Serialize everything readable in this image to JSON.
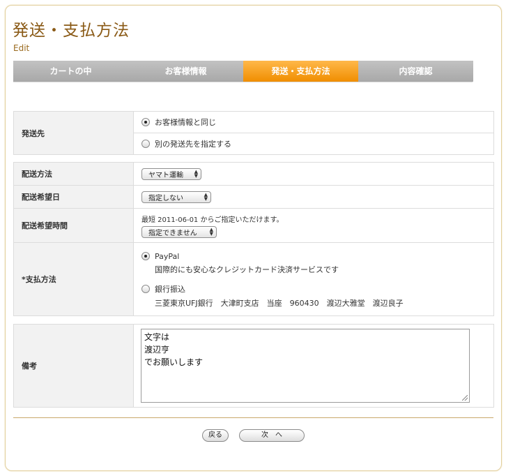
{
  "page": {
    "title": "発送・支払方法",
    "edit_link": "Edit"
  },
  "steps": [
    {
      "label": "カートの中",
      "active": false
    },
    {
      "label": "お客様情報",
      "active": false
    },
    {
      "label": "発送・支払方法",
      "active": true
    },
    {
      "label": "内容確認",
      "active": false
    }
  ],
  "shipping_destination": {
    "label": "発送先",
    "options": [
      {
        "label": "お客様情報と同じ",
        "checked": true
      },
      {
        "label": "別の発送先を指定する",
        "checked": false
      }
    ]
  },
  "delivery": {
    "method": {
      "label": "配送方法",
      "selected": "ヤマト運輸"
    },
    "date": {
      "label": "配送希望日",
      "selected": "指定しない"
    },
    "time": {
      "label": "配送希望時間",
      "note": "最短 2011-06-01 からご指定いただけます。",
      "selected": "指定できません"
    },
    "payment": {
      "label": "*支払方法",
      "options": [
        {
          "label": "PayPal",
          "description": "国際的にも安心なクレジットカード決済サービスです",
          "checked": true
        },
        {
          "label": "銀行振込",
          "description": "三菱東京UFJ銀行　大津町支店　当座　960430　渡辺大雅堂　渡辺良子",
          "checked": false
        }
      ]
    }
  },
  "remarks": {
    "label": "備考",
    "lines": [
      "文字は",
      "渡辺亨",
      "でお願いします"
    ]
  },
  "buttons": {
    "back": "戻る",
    "next": "次　へ"
  },
  "colors": {
    "title": "#8a5a16",
    "active_step": "#f59a10",
    "inactive_step": "#b4b4b4",
    "frame_border": "#e2cf9c"
  }
}
